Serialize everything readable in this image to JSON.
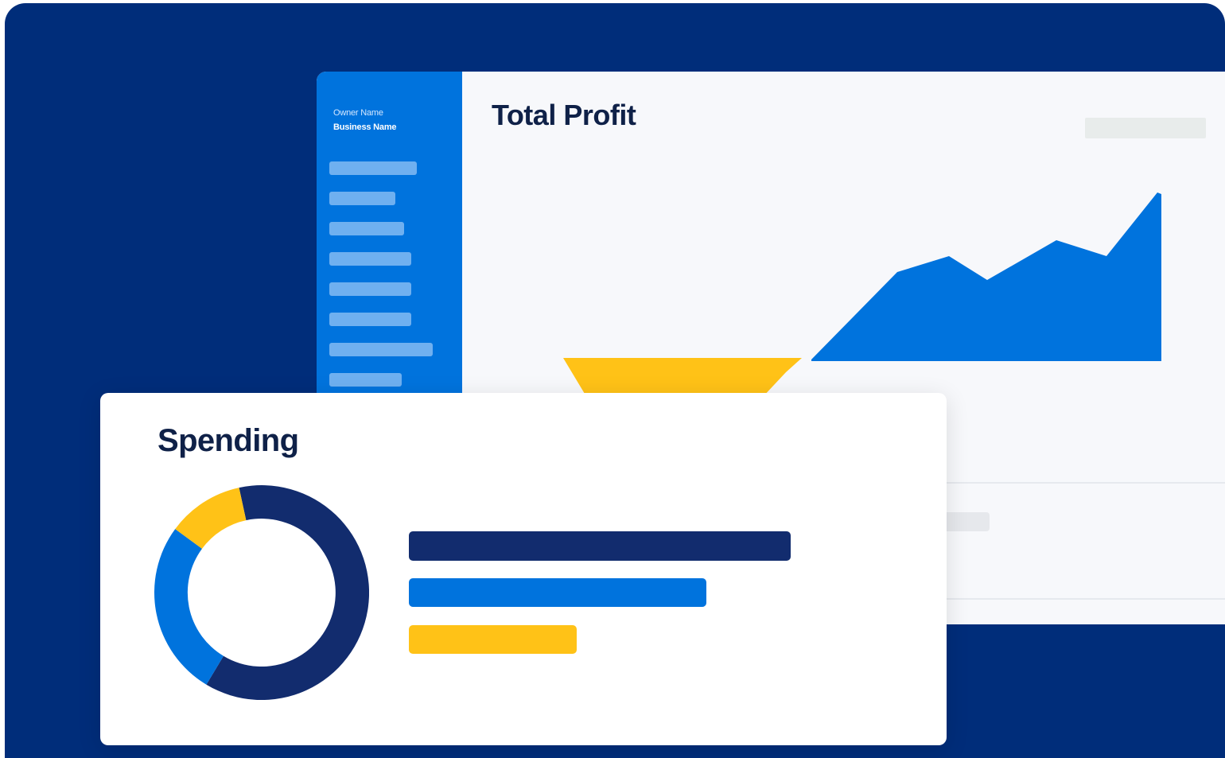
{
  "dashboard": {
    "sidebar": {
      "owner_label": "Owner Name",
      "business_label": "Business Name",
      "nav_item_count": 8
    },
    "total_profit": {
      "title": "Total Profit"
    }
  },
  "spending": {
    "title": "Spending"
  },
  "colors": {
    "background": "#002d7a",
    "sidebar": "#0073dd",
    "primary_blue": "#0073dd",
    "navy": "#122c6e",
    "yellow": "#ffc217"
  },
  "chart_data": [
    {
      "type": "area",
      "title": "Total Profit",
      "xlabel": "",
      "ylabel": "",
      "grid": false,
      "series": [
        {
          "values": [
            0,
            0,
            0,
            0
          ]
        },
        {
          "values": [
            0,
            45,
            52,
            41,
            55,
            50,
            68
          ]
        }
      ]
    },
    {
      "type": "pie",
      "title": "Spending",
      "donut": true,
      "values": [
        72,
        16,
        12
      ],
      "colors": [
        "#122c6e",
        "#0073dd",
        "#ffc217"
      ]
    },
    {
      "type": "bar",
      "orientation": "horizontal",
      "values": [
        100,
        78,
        44
      ],
      "colors": [
        "#122c6e",
        "#0073dd",
        "#ffc217"
      ]
    }
  ]
}
